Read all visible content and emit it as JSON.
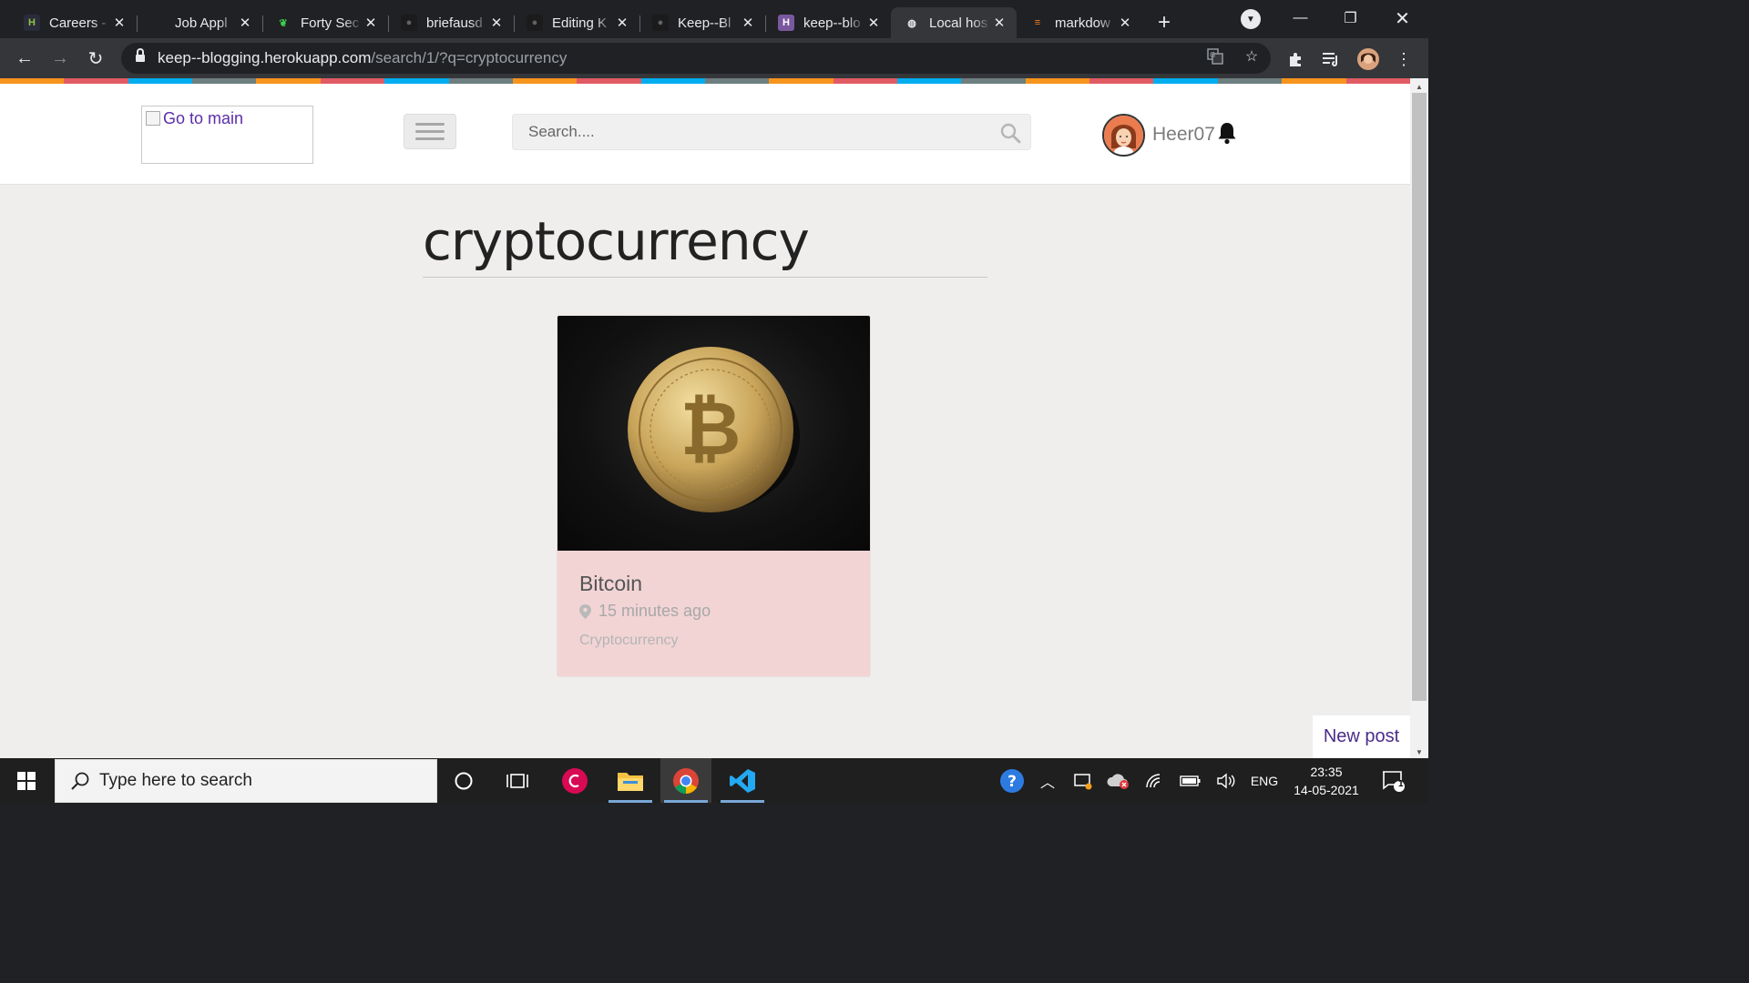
{
  "browser": {
    "tabs": [
      {
        "title": "Careers -",
        "favicon": "hackerearth-icon",
        "active": false
      },
      {
        "title": "Job Appl",
        "favicon": "blank-icon",
        "active": false
      },
      {
        "title": "Forty Sec",
        "favicon": "leaf-icon",
        "active": false
      },
      {
        "title": "briefausd",
        "favicon": "github-icon",
        "active": false
      },
      {
        "title": "Editing K",
        "favicon": "github-icon",
        "active": false
      },
      {
        "title": "Keep--Bl",
        "favicon": "github-icon",
        "active": false
      },
      {
        "title": "keep--blo",
        "favicon": "heroku-icon",
        "active": false
      },
      {
        "title": "Local hos",
        "favicon": "globe-icon",
        "active": true
      },
      {
        "title": "markdow",
        "favicon": "stackoverflow-icon",
        "active": false
      }
    ],
    "url_host": "keep--blogging.herokuapp.com",
    "url_path": "/search/1/?q=cryptocurrency"
  },
  "site": {
    "logo_alt": "Go to main",
    "search_placeholder": "Search....",
    "username": "Heer07",
    "search_heading": "cryptocurrency",
    "stripe_colors": [
      "#f7941d",
      "#e15b64",
      "#00aeef",
      "#6e7f80"
    ]
  },
  "results": [
    {
      "title": "Bitcoin",
      "time": "15 minutes ago",
      "category": "Cryptocurrency"
    }
  ],
  "new_post_label": "New post",
  "taskbar": {
    "search_placeholder": "Type here to search",
    "language": "ENG",
    "time": "23:35",
    "date": "14-05-2021",
    "notification_count": "1"
  }
}
